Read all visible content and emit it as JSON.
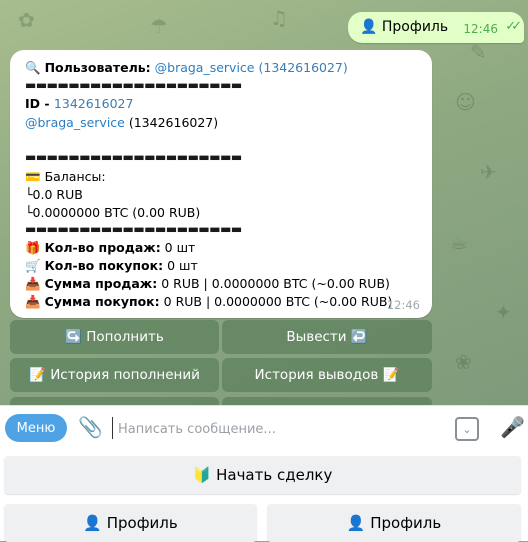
{
  "outgoing": {
    "text": "👤 Профиль",
    "time": "12:46",
    "checks": "✓✓"
  },
  "incoming": {
    "user_label": "Пользователь:",
    "username": "@braga_service",
    "user_id_paren": "(1342616027)",
    "separator": "▬▬▬▬▬▬▬▬▬▬▬▬▬▬▬▬▬▬▬▬",
    "id_label": "ID - ",
    "id_value": "1342616027",
    "username2": "@braga_service",
    "user_id_paren2": "(1342616027)",
    "balances_label": "Балансы:",
    "balance_rub": "└0.0 RUB",
    "balance_btc": "└0.0000000 BTC (0.00 RUB)",
    "sales_count_label": "Кол-во продаж:",
    "sales_count_value": " 0 шт",
    "purchases_count_label": "Кол-во покупок:",
    "purchases_count_value": " 0 шт",
    "sales_sum_label": "Сумма продаж:",
    "sales_sum_value": " 0 RUB | 0.0000000 BTC (~0.00 RUB)",
    "purchases_sum_label": "Сумма покупок:",
    "purchases_sum_value": " 0 RUB | 0.0000000 BTC (~0.00 RUB)",
    "time": "12:46"
  },
  "inline_keyboard": {
    "deposit": "↪️ Пополнить",
    "withdraw": "Вывести ↩️",
    "deposit_history": "📝 История пополнений",
    "withdraw_history": "История выводов 📝"
  },
  "composer": {
    "menu_label": "Меню",
    "placeholder": "Написать сообщение..."
  },
  "reply_keyboard": {
    "start_deal": "🔰 Начать сделку",
    "profile_left": "👤 Профиль",
    "profile_right": "👤 Профиль"
  },
  "icons": {
    "search": "magnifier-icon",
    "card": "credit-card-icon",
    "gift": "gift-icon",
    "cart": "cart-icon",
    "inbox": "inbox-tray-icon",
    "clip": "paperclip-icon",
    "keyboard": "keyboard-icon",
    "mic": "microphone-icon"
  },
  "colors": {
    "accent": "#4fa3e5",
    "link": "#2a7fc4",
    "outgoing_bubble": "#e2ffc7",
    "check": "#4fae4e"
  }
}
